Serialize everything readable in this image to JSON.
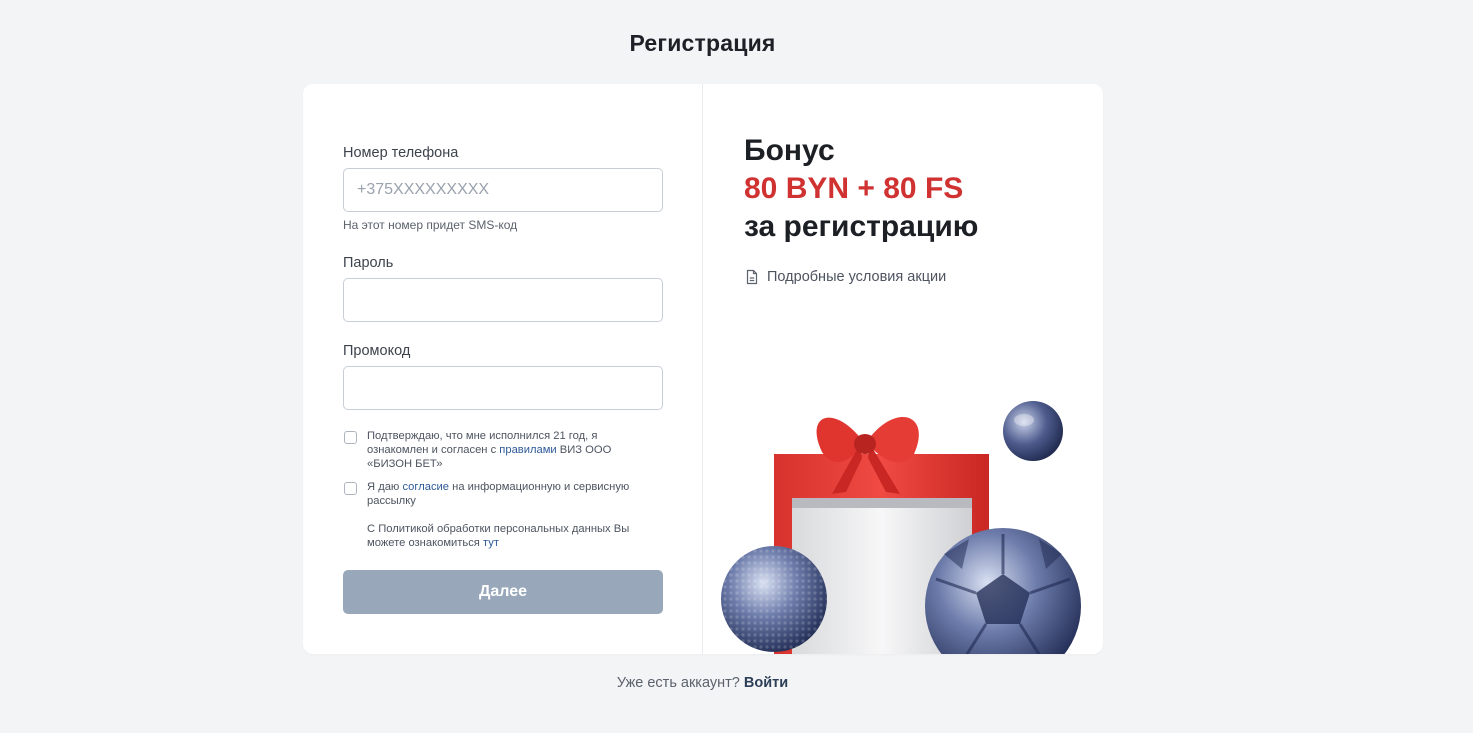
{
  "page": {
    "title": "Регистрация"
  },
  "form": {
    "phone": {
      "label": "Номер телефона",
      "placeholder": "+375XXXXXXXXX",
      "value": "",
      "hint": "На этот номер придет SMS-код"
    },
    "password": {
      "label": "Пароль",
      "value": ""
    },
    "promo": {
      "label": "Промокод",
      "value": ""
    },
    "consent_age": {
      "checked": false,
      "text_before": "Подтверждаю, что мне исполнился 21 год, я ознакомлен и согласен с ",
      "link": "правилами",
      "text_after": " ВИЗ ООО «БИЗОН БЕТ»"
    },
    "consent_mailing": {
      "checked": false,
      "text_before": "Я даю ",
      "link": "согласие",
      "text_after": " на информационную и сервисную рассылку"
    },
    "privacy": {
      "text_before": "С Политикой обработки персональных данных Вы можете ознакомиться ",
      "link": "тут"
    },
    "submit_label": "Далее"
  },
  "promo": {
    "line1": "Бонус",
    "amount": "80 BYN + 80 FS",
    "line3": "за регистрацию",
    "terms_link": "Подробные условия акции",
    "terms_icon": "document-icon"
  },
  "footer": {
    "question": "Уже есть аккаунт?",
    "login_link": "Войти"
  },
  "colors": {
    "accent_red": "#d03232",
    "button_disabled": "#98a8ba",
    "link": "#2e5a9a",
    "background": "#f3f4f6"
  }
}
